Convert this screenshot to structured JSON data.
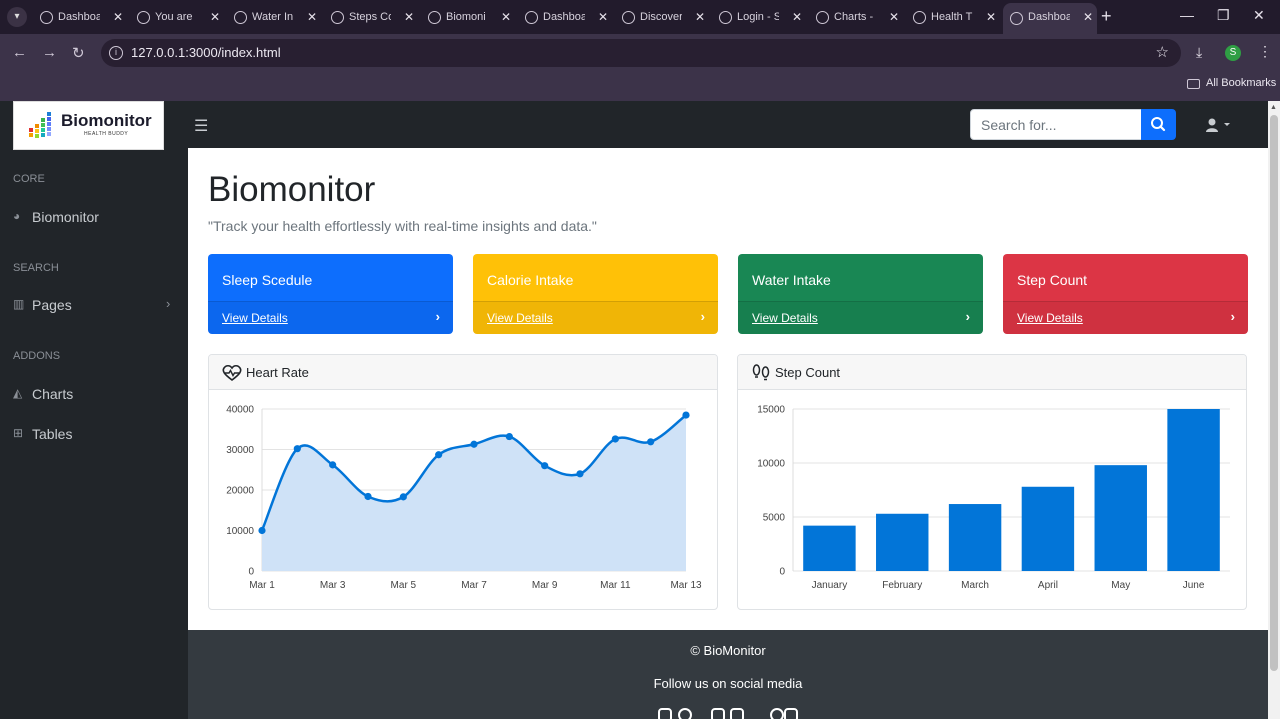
{
  "browser": {
    "tabs": [
      {
        "label": "Dashboard",
        "active": false
      },
      {
        "label": "You are",
        "active": false
      },
      {
        "label": "Water In",
        "active": false
      },
      {
        "label": "Steps Co",
        "active": false
      },
      {
        "label": "Biomoni",
        "active": false
      },
      {
        "label": "Dashboa",
        "active": false
      },
      {
        "label": "Discover",
        "active": false
      },
      {
        "label": "Login - S",
        "active": false
      },
      {
        "label": "Charts -",
        "active": false
      },
      {
        "label": "Health T",
        "active": false
      },
      {
        "label": "Dashboa",
        "active": true
      }
    ],
    "url": "127.0.0.1:3000/index.html",
    "profile_initial": "S",
    "bookmarks_label": "All Bookmarks"
  },
  "brand": {
    "name": "Biomonitor",
    "tagline": "HEALTH BUDDY"
  },
  "sidebar": {
    "sections": [
      {
        "heading": "CORE",
        "items": [
          {
            "label": "Biomonitor",
            "icon": "gauge-icon"
          }
        ]
      },
      {
        "heading": "SEARCH",
        "items": [
          {
            "label": "Pages",
            "icon": "book-icon",
            "expandable": true
          }
        ]
      },
      {
        "heading": "ADDONS",
        "items": [
          {
            "label": "Charts",
            "icon": "chart-area-icon"
          },
          {
            "label": "Tables",
            "icon": "table-icon"
          }
        ]
      }
    ]
  },
  "topbar": {
    "search_placeholder": "Search for..."
  },
  "main": {
    "title": "Biomonitor",
    "subtitle": "\"Track your health effortlessly with real-time insights and data.\"",
    "cards": [
      {
        "title": "Sleep Scedule",
        "link": "View Details",
        "color": "#0d6efd"
      },
      {
        "title": "Calorie Intake",
        "link": "View Details",
        "color": "#ffc107"
      },
      {
        "title": "Water Intake",
        "link": "View Details",
        "color": "#198754"
      },
      {
        "title": "Step Count",
        "link": "View Details",
        "color": "#dc3545"
      }
    ],
    "panels": [
      {
        "title": "Heart Rate"
      },
      {
        "title": "Step Count"
      }
    ]
  },
  "chart_data": [
    {
      "type": "area",
      "title": "Heart Rate",
      "x": [
        "Mar 1",
        "Mar 2",
        "Mar 3",
        "Mar 4",
        "Mar 5",
        "Mar 6",
        "Mar 7",
        "Mar 8",
        "Mar 9",
        "Mar 10",
        "Mar 11",
        "Mar 12",
        "Mar 13"
      ],
      "x_tick_labels": [
        "Mar 1",
        "Mar 3",
        "Mar 5",
        "Mar 7",
        "Mar 9",
        "Mar 11",
        "Mar 13"
      ],
      "values": [
        10000,
        30200,
        26200,
        18400,
        18300,
        28700,
        31300,
        33200,
        26000,
        24000,
        32600,
        31900,
        38500
      ],
      "ylim": [
        0,
        40000
      ],
      "y_ticks": [
        0,
        10000,
        20000,
        30000,
        40000
      ],
      "grid": true,
      "line_color": "#0275d8",
      "fill_color": "#cfe2f7"
    },
    {
      "type": "bar",
      "title": "Step Count",
      "categories": [
        "January",
        "February",
        "March",
        "April",
        "May",
        "June"
      ],
      "values": [
        4200,
        5300,
        6200,
        7800,
        9800,
        15000
      ],
      "ylim": [
        0,
        15000
      ],
      "y_ticks": [
        0,
        5000,
        10000,
        15000
      ],
      "grid": true,
      "bar_color": "#0275d8"
    }
  ],
  "footer": {
    "copyright": "© BioMonitor",
    "follow": "Follow us on social media",
    "social": [
      "instagram-icon",
      "facebook-icon",
      "twitter-icon",
      "twitter-icon",
      "facebook-icon",
      "instagram-icon"
    ]
  }
}
